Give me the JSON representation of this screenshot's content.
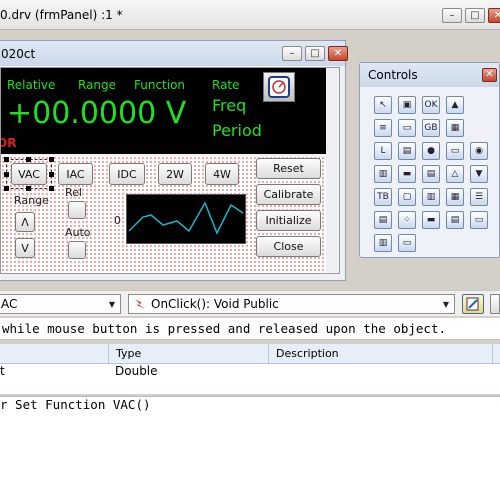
{
  "main_window": {
    "title": "0.drv (frmPanel) :1 *",
    "buttons": {
      "minimize": "–",
      "maximize": "□",
      "close": "✕"
    }
  },
  "panel_window": {
    "title": "020ct",
    "buttons": {
      "minimize": "–",
      "maximize": "□",
      "close": "✕"
    },
    "display": {
      "labels": {
        "relative": "Relative",
        "range": "Range",
        "function": "Function",
        "rate": "Rate"
      },
      "reading": "+00.0000 V",
      "rate_freq": "Freq",
      "rate_period": "Period",
      "red_text": "OR"
    },
    "function_buttons": [
      "VAC",
      "IAC",
      "IDC",
      "2W",
      "4W"
    ],
    "range_label": "Range",
    "rel_label": "Rel",
    "auto_label": "Auto",
    "graph_zero_label": "0",
    "up_glyph": "Λ",
    "down_glyph": "V",
    "action_buttons": [
      "Reset",
      "Calibrate",
      "Initialize",
      "Close"
    ]
  },
  "controls": {
    "title": "Controls",
    "close_label": "✕",
    "tools": [
      {
        "icon": "pointer-icon",
        "glyph": "↖"
      },
      {
        "icon": "form-icon",
        "glyph": "▣"
      },
      {
        "icon": "ok-button-icon",
        "glyph": "OK"
      },
      {
        "icon": "picture-icon",
        "glyph": "▲"
      },
      {
        "icon": "listbox-icon",
        "glyph": "≡"
      },
      {
        "icon": "panel-icon",
        "glyph": "▭"
      },
      {
        "icon": "gauge-icon",
        "glyph": "GB"
      },
      {
        "icon": "image-icon",
        "glyph": "▦"
      },
      {
        "icon": "label-icon",
        "glyph": "L"
      },
      {
        "icon": "table-icon",
        "glyph": "▤"
      },
      {
        "icon": "globe-icon",
        "glyph": "●"
      },
      {
        "icon": "textbox-icon",
        "glyph": "▭"
      },
      {
        "icon": "radio-icon",
        "glyph": "◉"
      },
      {
        "icon": "grid-icon",
        "glyph": "▥"
      },
      {
        "icon": "slider-icon",
        "glyph": "▬"
      },
      {
        "icon": "meter-icon",
        "glyph": "▤"
      },
      {
        "icon": "flask-icon",
        "glyph": "△"
      },
      {
        "icon": "combo-icon",
        "glyph": "▼"
      },
      {
        "icon": "textbox-tb-icon",
        "glyph": "TB"
      },
      {
        "icon": "frame-icon",
        "glyph": "▢"
      },
      {
        "icon": "scroll-icon",
        "glyph": "▥"
      },
      {
        "icon": "tree-icon",
        "glyph": "▦"
      },
      {
        "icon": "list-icon",
        "glyph": "☰"
      },
      {
        "icon": "tab-icon",
        "glyph": "▤"
      },
      {
        "icon": "dots-icon",
        "glyph": "⁘"
      },
      {
        "icon": "hscroll-icon",
        "glyph": "▬"
      },
      {
        "icon": "progress-icon",
        "glyph": "▤"
      },
      {
        "icon": "toolbar-icon",
        "glyph": "▭"
      },
      {
        "icon": "split-icon",
        "glyph": "▥"
      },
      {
        "icon": "status-icon",
        "glyph": "▭"
      },
      {
        "icon": "chart-icon",
        "glyph": "▟"
      },
      {
        "icon": "doc-icon",
        "glyph": "▤"
      }
    ]
  },
  "object_combo": {
    "value": "AC"
  },
  "event_combo": {
    "value": "OnClick(): Void Public"
  },
  "hint": "while mouse button is pressed and released upon the object.",
  "grid": {
    "headers": [
      "Type",
      "Description"
    ],
    "row": {
      "name": "t",
      "type": "Double",
      "description": ""
    }
  },
  "code": {
    "line": "r Set Function VAC()"
  }
}
